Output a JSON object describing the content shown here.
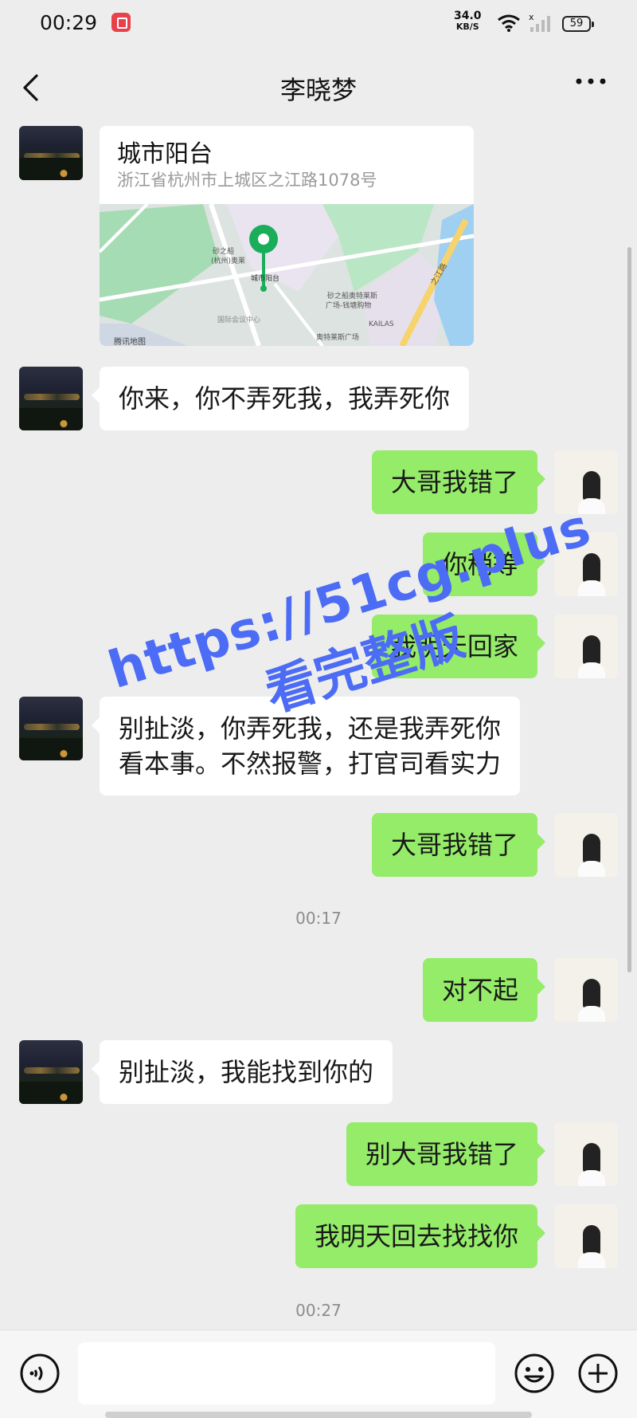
{
  "status_bar": {
    "time": "00:29",
    "net_speed": "34.0",
    "net_unit": "KB/S",
    "battery": "59"
  },
  "header": {
    "title": "李晓梦"
  },
  "location": {
    "name": "城市阳台",
    "address": "浙江省杭州市上城区之江路1078号",
    "map_labels": {
      "place": "城市阳台",
      "poi1": "砂之船",
      "poi1b": "(杭州)奥莱",
      "poi2": "砂之船奥特莱斯",
      "poi2b": "广场-钱塘购物",
      "road": "之江路",
      "center": "国际会议中心",
      "mall": "奥特莱斯广场",
      "kailas": "KAILAS",
      "provider": "腾讯地图"
    }
  },
  "messages": [
    {
      "side": "in",
      "text": "你来，你不弄死我，我弄死你"
    },
    {
      "side": "out",
      "text": "大哥我错了"
    },
    {
      "side": "out",
      "text": "你稍等"
    },
    {
      "side": "out",
      "text": "我明天回家"
    },
    {
      "side": "in",
      "line1": "别扯淡，你弄死我，还是我弄死你",
      "line2": "看本事。不然报警，打官司看实力"
    },
    {
      "side": "out",
      "text": "大哥我错了"
    },
    {
      "side": "out",
      "text": "对不起"
    },
    {
      "side": "in",
      "text": "别扯淡，我能找到你的"
    },
    {
      "side": "out",
      "text": "别大哥我错了"
    },
    {
      "side": "out",
      "text": "我明天回去找找你"
    }
  ],
  "timestamps": [
    "00:17",
    "00:27"
  ],
  "input": {
    "value": ""
  },
  "watermark": {
    "line1": "https://51cg.plus",
    "line2": "看完整版"
  },
  "colors": {
    "out_bubble": "#95ec69",
    "in_bubble": "#ffffff",
    "background": "#ededed",
    "map_pin": "#1aad5a",
    "watermark": "#4c6cf5"
  },
  "icons": [
    "back-icon",
    "more-icon",
    "wifi-icon",
    "signal-icon",
    "voice-icon",
    "emoji-icon",
    "plus-icon",
    "map-pin-icon"
  ]
}
